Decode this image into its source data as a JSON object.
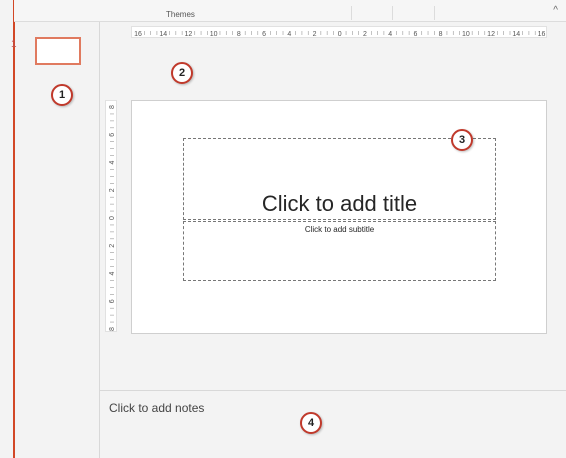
{
  "ribbon": {
    "themes_label": "Themes",
    "collapse_glyph": "^"
  },
  "thumbnails": {
    "slide_number": "1"
  },
  "ruler": {
    "horizontal_labels": [
      "16",
      "14",
      "12",
      "10",
      "8",
      "6",
      "4",
      "2",
      "0",
      "2",
      "4",
      "6",
      "8",
      "10",
      "12",
      "14",
      "16"
    ],
    "vertical_labels": [
      "8",
      "6",
      "4",
      "2",
      "0",
      "2",
      "4",
      "6",
      "8"
    ]
  },
  "slide": {
    "title_placeholder": "Click to add title",
    "subtitle_placeholder": "Click to add subtitle"
  },
  "notes": {
    "placeholder": "Click to add notes"
  },
  "callouts": [
    "1",
    "2",
    "3",
    "4"
  ],
  "colors": {
    "accent": "#d24726",
    "callout_border": "#c0392b"
  }
}
